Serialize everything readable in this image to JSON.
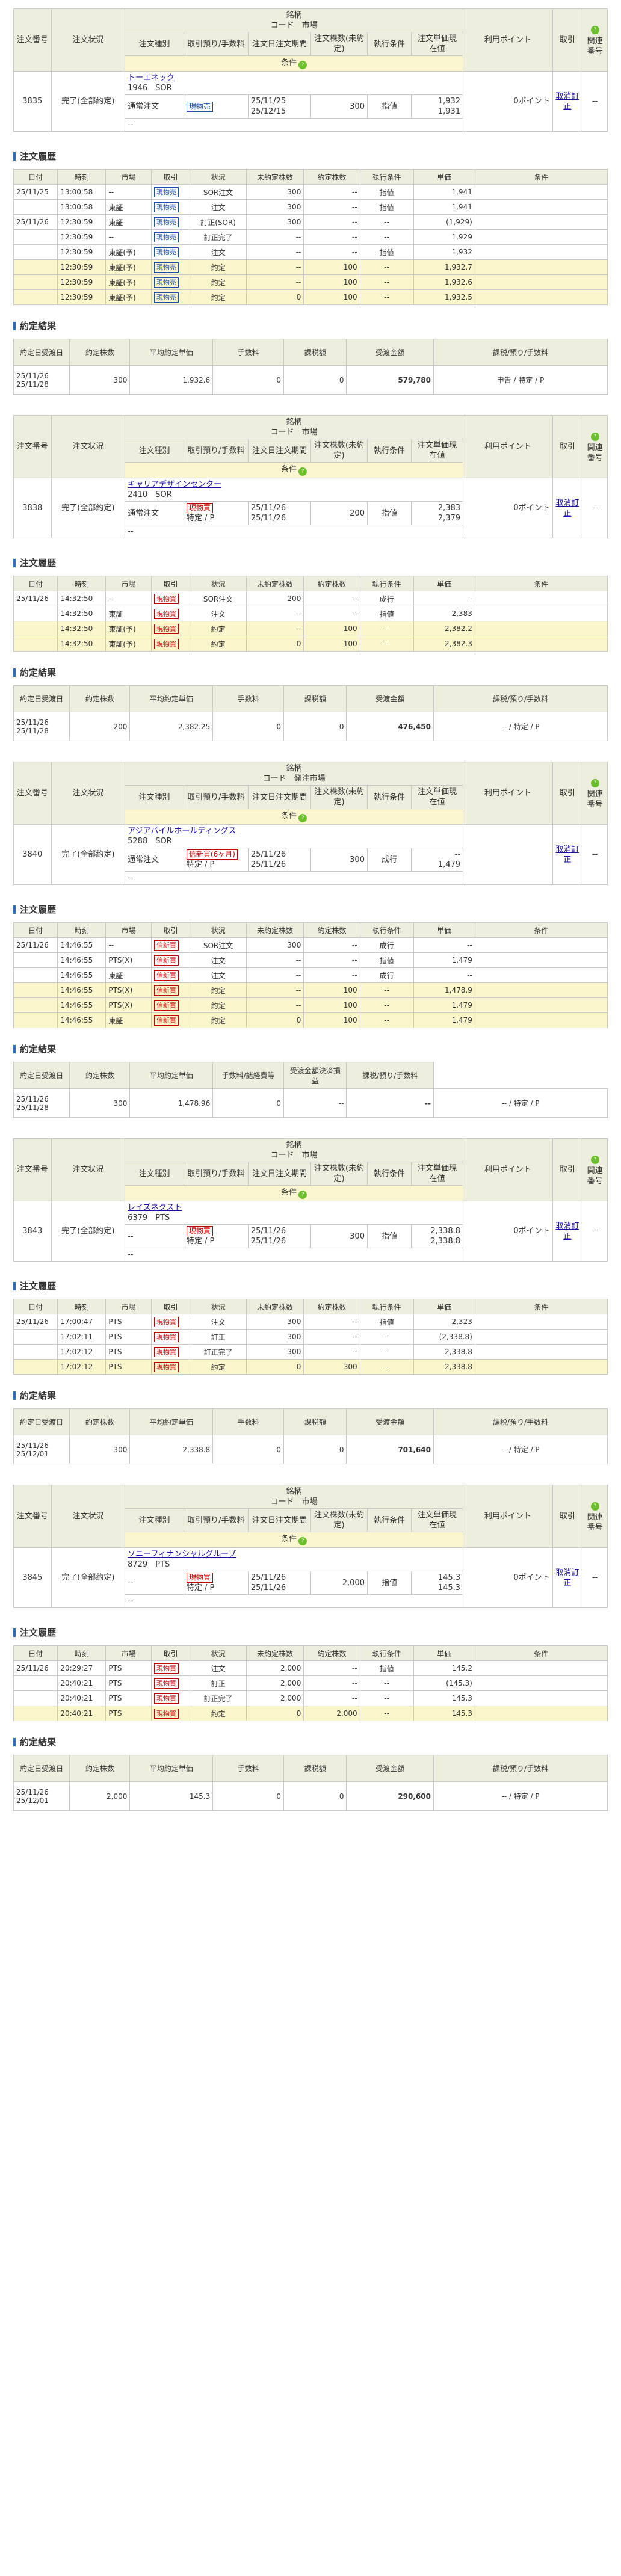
{
  "labels": {
    "history_title": "注文履歴",
    "exec_title": "約定結果",
    "cond_label": "条件",
    "order_headers": {
      "order_no": "注文番号",
      "status": "注文状況",
      "brand": "銘柄",
      "code_market": "コード　市場",
      "code_market_2": "コード　発注市場",
      "order_type": "注文種別",
      "trade_fee": "取引預り/手数料",
      "order_date": "注文日注文期間",
      "qty": "注文株数(未約定)",
      "exec_cond": "執行条件",
      "price": "注文単価現在値",
      "points": "利用ポイント",
      "cancel": "取引",
      "related": "関連番号"
    },
    "history_headers": [
      "日付",
      "時刻",
      "市場",
      "取引",
      "状況",
      "未約定株数",
      "約定株数",
      "執行条件",
      "単価",
      "条件"
    ],
    "exec_headers": [
      "約定日受渡日",
      "約定株数",
      "平均約定単価",
      "手数料",
      "課税額",
      "受渡金額",
      "課税/預り/手数料"
    ],
    "exec_headers_alt": [
      "約定日受渡日",
      "約定株数",
      "平均約定単価",
      "手数料/諸経費等",
      "受渡金額決済損益",
      "課税/預り/手数料"
    ]
  },
  "orders": [
    {
      "order_no": "3835",
      "status": "完了(全部約定)",
      "brand_name": "トーエネック",
      "code": "1946",
      "market": "SOR",
      "order_type": "通常注文",
      "trade": "現物売",
      "fee": "",
      "order_date": "25/11/25",
      "order_period": "25/12/15",
      "qty": "300",
      "exec_cond": "指値",
      "price": "1,932",
      "current": "1,931",
      "points": "0ポイント",
      "cancel": "取消訂正",
      "related": "--",
      "history": [
        [
          "25/11/25",
          "13:00:58",
          "--",
          "現物売",
          "SOR注文",
          "300",
          "--",
          "指値",
          "1,941",
          ""
        ],
        [
          "",
          "13:00:58",
          "東証",
          "現物売",
          "注文",
          "300",
          "--",
          "指値",
          "1,941",
          ""
        ],
        [
          "25/11/26",
          "12:30:59",
          "東証",
          "現物売",
          "訂正(SOR)",
          "300",
          "--",
          "--",
          "(1,929)",
          ""
        ],
        [
          "",
          "12:30:59",
          "--",
          "現物売",
          "訂正完了",
          "--",
          "--",
          "--",
          "1,929",
          ""
        ],
        [
          "",
          "12:30:59",
          "東証(予)",
          "現物売",
          "注文",
          "--",
          "--",
          "指値",
          "1,932",
          ""
        ],
        [
          "",
          "12:30:59",
          "東証(予)",
          "現物売",
          "約定",
          "--",
          "100",
          "--",
          "1,932.7",
          ""
        ],
        [
          "",
          "12:30:59",
          "東証(予)",
          "現物売",
          "約定",
          "--",
          "100",
          "--",
          "1,932.6",
          ""
        ],
        [
          "",
          "12:30:59",
          "東証(予)",
          "現物売",
          "約定",
          "0",
          "100",
          "--",
          "1,932.5",
          ""
        ]
      ],
      "history_highlight": [
        5,
        6,
        7
      ],
      "exec": [
        "25/11/26",
        "25/11/28",
        "300",
        "1,932.6",
        "0",
        "0",
        "579,780",
        "申告 / 特定 / P"
      ]
    },
    {
      "order_no": "3838",
      "status": "完了(全部約定)",
      "brand_name": "キャリアデザインセンター",
      "code": "2410",
      "market": "SOR",
      "order_type": "通常注文",
      "trade": "現物買",
      "fee": "特定 / P",
      "order_date": "25/11/26",
      "order_period": "25/11/26",
      "qty": "200",
      "exec_cond": "指値",
      "price": "2,383",
      "current": "2,379",
      "points": "0ポイント",
      "cancel": "取消訂正",
      "related": "--",
      "history": [
        [
          "25/11/26",
          "14:32:50",
          "--",
          "現物買",
          "SOR注文",
          "200",
          "--",
          "成行",
          "--",
          ""
        ],
        [
          "",
          "14:32:50",
          "東証",
          "現物買",
          "注文",
          "--",
          "--",
          "指値",
          "2,383",
          ""
        ],
        [
          "",
          "14:32:50",
          "東証(予)",
          "現物買",
          "約定",
          "--",
          "100",
          "--",
          "2,382.2",
          ""
        ],
        [
          "",
          "14:32:50",
          "東証(予)",
          "現物買",
          "約定",
          "0",
          "100",
          "--",
          "2,382.3",
          ""
        ]
      ],
      "history_highlight": [
        2,
        3
      ],
      "exec": [
        "25/11/26",
        "25/11/28",
        "200",
        "2,382.25",
        "0",
        "0",
        "476,450",
        "-- / 特定 / P"
      ]
    },
    {
      "order_no": "3840",
      "status": "完了(全部約定)",
      "brand_name": "アジアパイルホールディングス",
      "code": "5288",
      "market": "SOR",
      "order_type": "通常注文",
      "trade": "信新買(6ヶ月)",
      "fee": "特定 / P",
      "order_date": "25/11/26",
      "order_period": "25/11/26",
      "qty": "300",
      "exec_cond": "成行",
      "price": "--",
      "current": "1,479",
      "points": "",
      "cancel": "取消訂正",
      "related": "--",
      "history": [
        [
          "25/11/26",
          "14:46:55",
          "--",
          "信新買",
          "SOR注文",
          "300",
          "--",
          "成行",
          "--",
          ""
        ],
        [
          "",
          "14:46:55",
          "PTS(X)",
          "信新買",
          "注文",
          "--",
          "--",
          "指値",
          "1,479",
          ""
        ],
        [
          "",
          "14:46:55",
          "東証",
          "信新買",
          "注文",
          "--",
          "--",
          "成行",
          "--",
          ""
        ],
        [
          "",
          "14:46:55",
          "PTS(X)",
          "信新買",
          "約定",
          "--",
          "100",
          "--",
          "1,478.9",
          ""
        ],
        [
          "",
          "14:46:55",
          "PTS(X)",
          "信新買",
          "約定",
          "--",
          "100",
          "--",
          "1,479",
          ""
        ],
        [
          "",
          "14:46:55",
          "東証",
          "信新買",
          "約定",
          "0",
          "100",
          "--",
          "1,479",
          ""
        ]
      ],
      "history_highlight": [
        3,
        4,
        5
      ],
      "exec": [
        "25/11/26",
        "25/11/28",
        "300",
        "1,478.96",
        "0",
        "--",
        "--",
        "-- / 特定 / P"
      ]
    },
    {
      "order_no": "3843",
      "status": "完了(全部約定)",
      "brand_name": "レイズネクスト",
      "code": "6379",
      "market": "PTS",
      "order_type": "--",
      "trade": "現物買",
      "fee": "特定 / P",
      "order_date": "25/11/26",
      "order_period": "25/11/26",
      "qty": "300",
      "exec_cond": "指値",
      "price": "2,338.8",
      "current": "2,338.8",
      "points": "0ポイント",
      "cancel": "取消訂正",
      "related": "--",
      "history": [
        [
          "25/11/26",
          "17:00:47",
          "PTS",
          "現物買",
          "注文",
          "300",
          "--",
          "指値",
          "2,323",
          ""
        ],
        [
          "",
          "17:02:11",
          "PTS",
          "現物買",
          "訂正",
          "300",
          "--",
          "--",
          "(2,338.8)",
          ""
        ],
        [
          "",
          "17:02:12",
          "PTS",
          "現物買",
          "訂正完了",
          "300",
          "--",
          "--",
          "2,338.8",
          ""
        ],
        [
          "",
          "17:02:12",
          "PTS",
          "現物買",
          "約定",
          "0",
          "300",
          "--",
          "2,338.8",
          ""
        ]
      ],
      "history_highlight": [
        3
      ],
      "exec": [
        "25/11/26",
        "25/12/01",
        "300",
        "2,338.8",
        "0",
        "0",
        "701,640",
        "-- / 特定 / P"
      ]
    },
    {
      "order_no": "3845",
      "status": "完了(全部約定)",
      "brand_name": "ソニーフィナンシャルグループ",
      "code": "8729",
      "market": "PTS",
      "order_type": "--",
      "trade": "現物買",
      "fee": "特定 / P",
      "order_date": "25/11/26",
      "order_period": "25/11/26",
      "qty": "2,000",
      "exec_cond": "指値",
      "price": "145.3",
      "current": "145.3",
      "points": "0ポイント",
      "cancel": "取消訂正",
      "related": "--",
      "history": [
        [
          "25/11/26",
          "20:29:27",
          "PTS",
          "現物買",
          "注文",
          "2,000",
          "--",
          "指値",
          "145.2",
          ""
        ],
        [
          "",
          "20:40:21",
          "PTS",
          "現物買",
          "訂正",
          "2,000",
          "--",
          "--",
          "(145.3)",
          ""
        ],
        [
          "",
          "20:40:21",
          "PTS",
          "現物買",
          "訂正完了",
          "2,000",
          "--",
          "--",
          "145.3",
          ""
        ],
        [
          "",
          "20:40:21",
          "PTS",
          "現物買",
          "約定",
          "0",
          "2,000",
          "--",
          "145.3",
          ""
        ]
      ],
      "history_highlight": [
        3
      ],
      "exec": [
        "25/11/26",
        "25/12/01",
        "2,000",
        "145.3",
        "0",
        "0",
        "290,600",
        "-- / 特定 / P"
      ]
    }
  ]
}
